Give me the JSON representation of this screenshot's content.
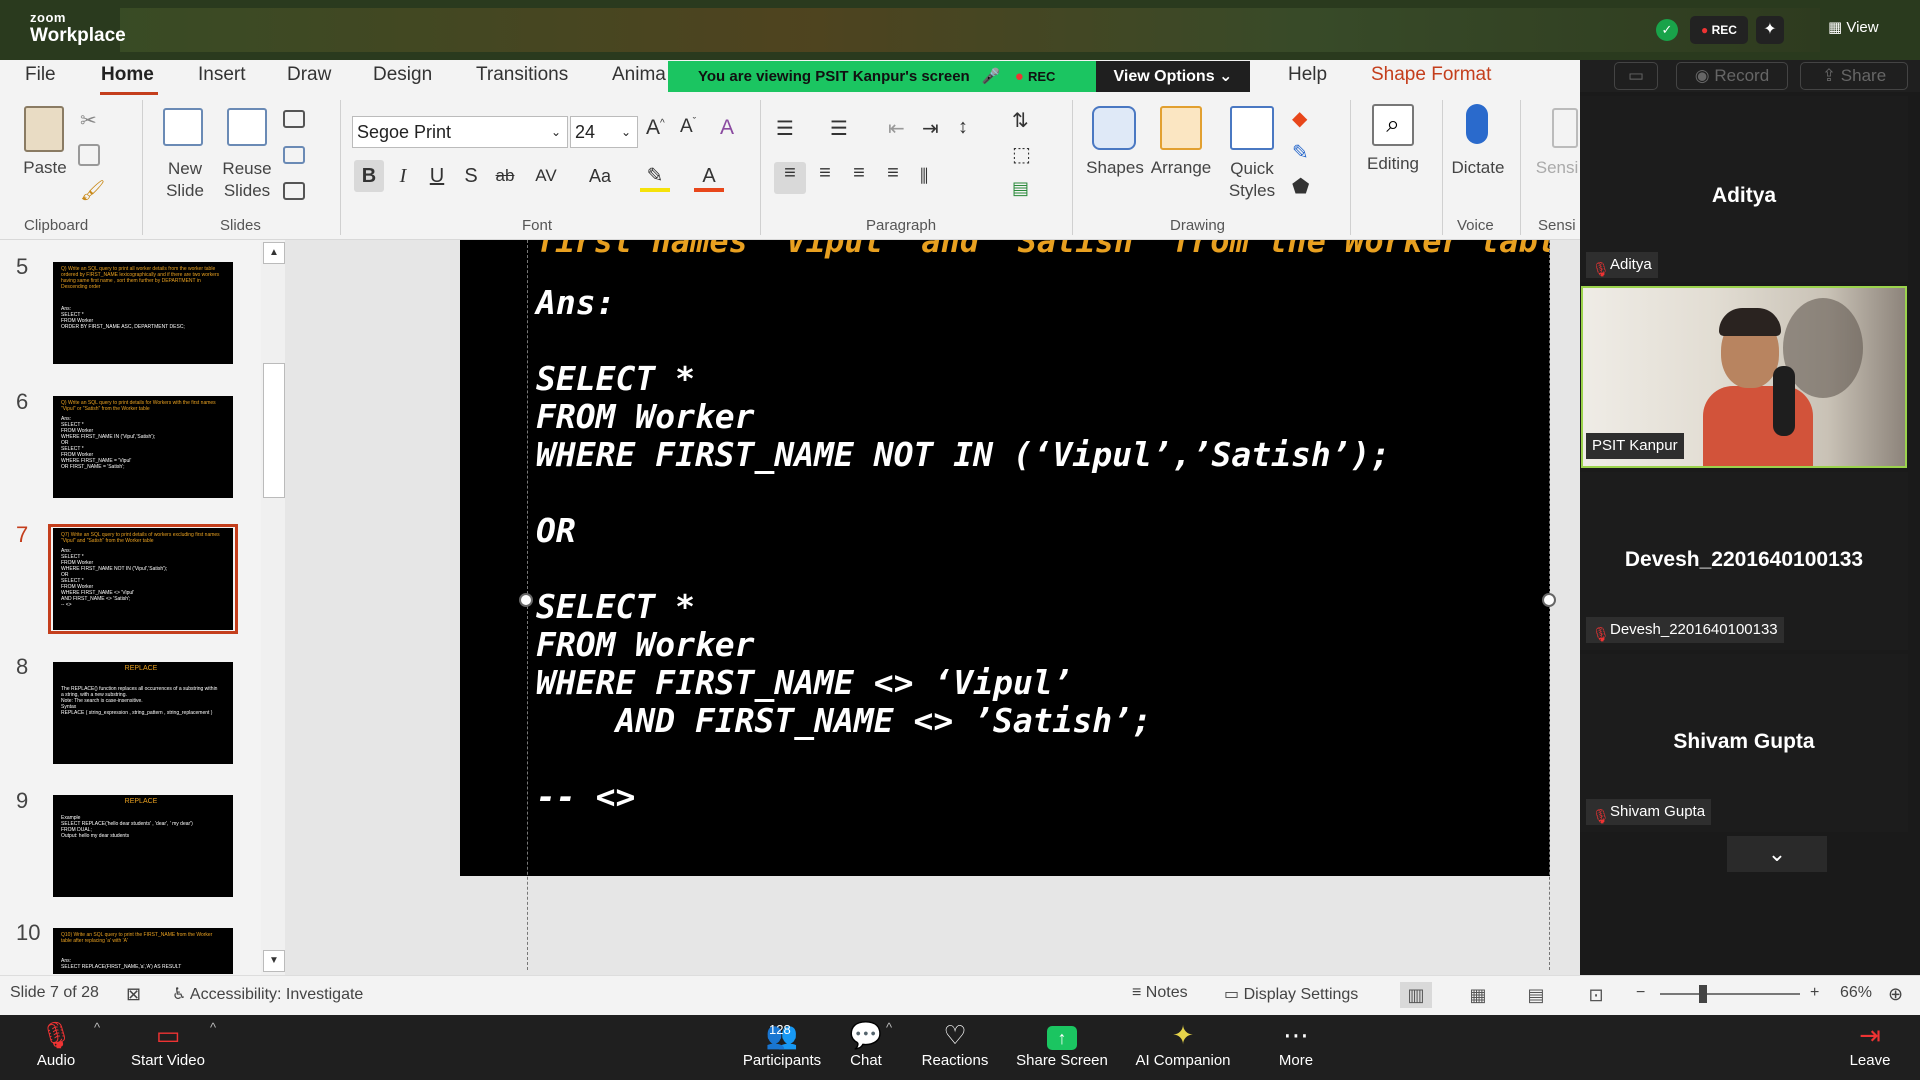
{
  "zoom": {
    "brand_small": "zoom",
    "brand_big": "Workplace",
    "rec_badge": "REC",
    "view_label": "View",
    "banner_text": "You are viewing  PSIT Kanpur's screen",
    "banner_rec": "REC",
    "view_options": "View Options",
    "panel_buttons": [
      "Record",
      "Share"
    ],
    "participants": [
      {
        "name": "Aditya",
        "tag": "Aditya"
      },
      {
        "name": "PSIT Kanpur",
        "tag": "PSIT Kanpur"
      },
      {
        "name": "Devesh_2201640100133",
        "tag": "Devesh_2201640100133"
      },
      {
        "name": "Shivam Gupta",
        "tag": "Shivam Gupta"
      }
    ],
    "toolbar": {
      "audio": "Audio",
      "start_video": "Start Video",
      "participants": "Participants",
      "participants_count": "128",
      "chat": "Chat",
      "reactions": "Reactions",
      "share_screen": "Share Screen",
      "ai_companion": "AI Companion",
      "more": "More",
      "leave": "Leave"
    }
  },
  "ppt": {
    "menu": [
      "File",
      "Home",
      "Insert",
      "Draw",
      "Design",
      "Transitions",
      "Anima",
      "Help",
      "Shape Format"
    ],
    "ribbon": {
      "paste": "Paste",
      "new_slide": [
        "New",
        "Slide"
      ],
      "reuse_slides": [
        "Reuse",
        "Slides"
      ],
      "font_name": "Segoe Print",
      "font_size": "24",
      "shapes": "Shapes",
      "arrange": "Arrange",
      "quick_styles": [
        "Quick",
        "Styles"
      ],
      "editing": "Editing",
      "dictate": "Dictate",
      "sensi": "Sensi",
      "groups": [
        "Clipboard",
        "Slides",
        "Font",
        "Paragraph",
        "Drawing",
        "Voice",
        "Sensi"
      ]
    },
    "thumbnails": [
      {
        "num": "5",
        "title": "Q) Write an SQL query to print all worker details from the worker table ordered by FIRST_NAME lexicographically and if there are two workers having same first name , sort them further by DEPARTMENT in Descending order",
        "body": "Ans:\nSELECT *\nFROM Worker\nORDER BY FIRST_NAME ASC, DEPARTMENT DESC;"
      },
      {
        "num": "6",
        "title": "Q) Write an SQL query to print details for Workers with the first names \"Vipul\" or \"Satish\" from the Worker table",
        "body": "Ans:\nSELECT *\nFROM Worker\nWHERE FIRST_NAME IN ('Vipul','Satish');\nOR\nSELECT *\nFROM Worker\nWHERE FIRST_NAME = 'Vipul'\n   OR FIRST_NAME = 'Satish';"
      },
      {
        "num": "7",
        "title": "Q7) Write an SQL query to print details of workers excluding first names \"Vipul\" and \"Satish\" from the Worker table",
        "body": "Ans:\nSELECT *\nFROM Worker\nWHERE FIRST_NAME NOT IN ('Vipul','Satish');\nOR\nSELECT *\nFROM Worker\nWHERE FIRST_NAME <> 'Vipul'\n   AND FIRST_NAME <> 'Satish';\n-- <>"
      },
      {
        "num": "8",
        "title": "REPLACE",
        "body": "The REPLACE() function replaces all occurrences of a substring within a string, with a new substring.\nNote: The search is case-insensitive.\nSyntax\nREPLACE ( string_expression , string_pattern , string_replacement )"
      },
      {
        "num": "9",
        "title": "REPLACE",
        "body": "Example\nSELECT REPLACE('hello dear students' , 'dear', ' my dear')\nFROM DUAL;\nOutput: hello my dear students"
      },
      {
        "num": "10",
        "title": "Q10) Write an SQL query to print the FIRST_NAME from the Worker table after replacing 'a' with 'A'",
        "body": "Ans:\nSELECT REPLACE(FIRST_NAME,'a','A') AS RESULT"
      }
    ],
    "slide": {
      "top_partial": "first names \"Vipul\" and \"Satish\" from the Worker table",
      "lines": [
        "Ans:",
        "",
        "SELECT *",
        "FROM Worker",
        "WHERE FIRST_NAME NOT IN (‘Vipul’,’Satish’);",
        "",
        "OR",
        "",
        "SELECT *",
        "FROM Worker",
        "WHERE FIRST_NAME <> ‘Vipul’",
        "    AND FIRST_NAME <> ’Satish’;",
        "",
        "-- <>"
      ]
    },
    "status": {
      "slide_counter": "Slide 7 of 28",
      "accessibility": "Accessibility: Investigate",
      "notes": "Notes",
      "display_settings": "Display Settings",
      "zoom_level": "66%"
    }
  }
}
